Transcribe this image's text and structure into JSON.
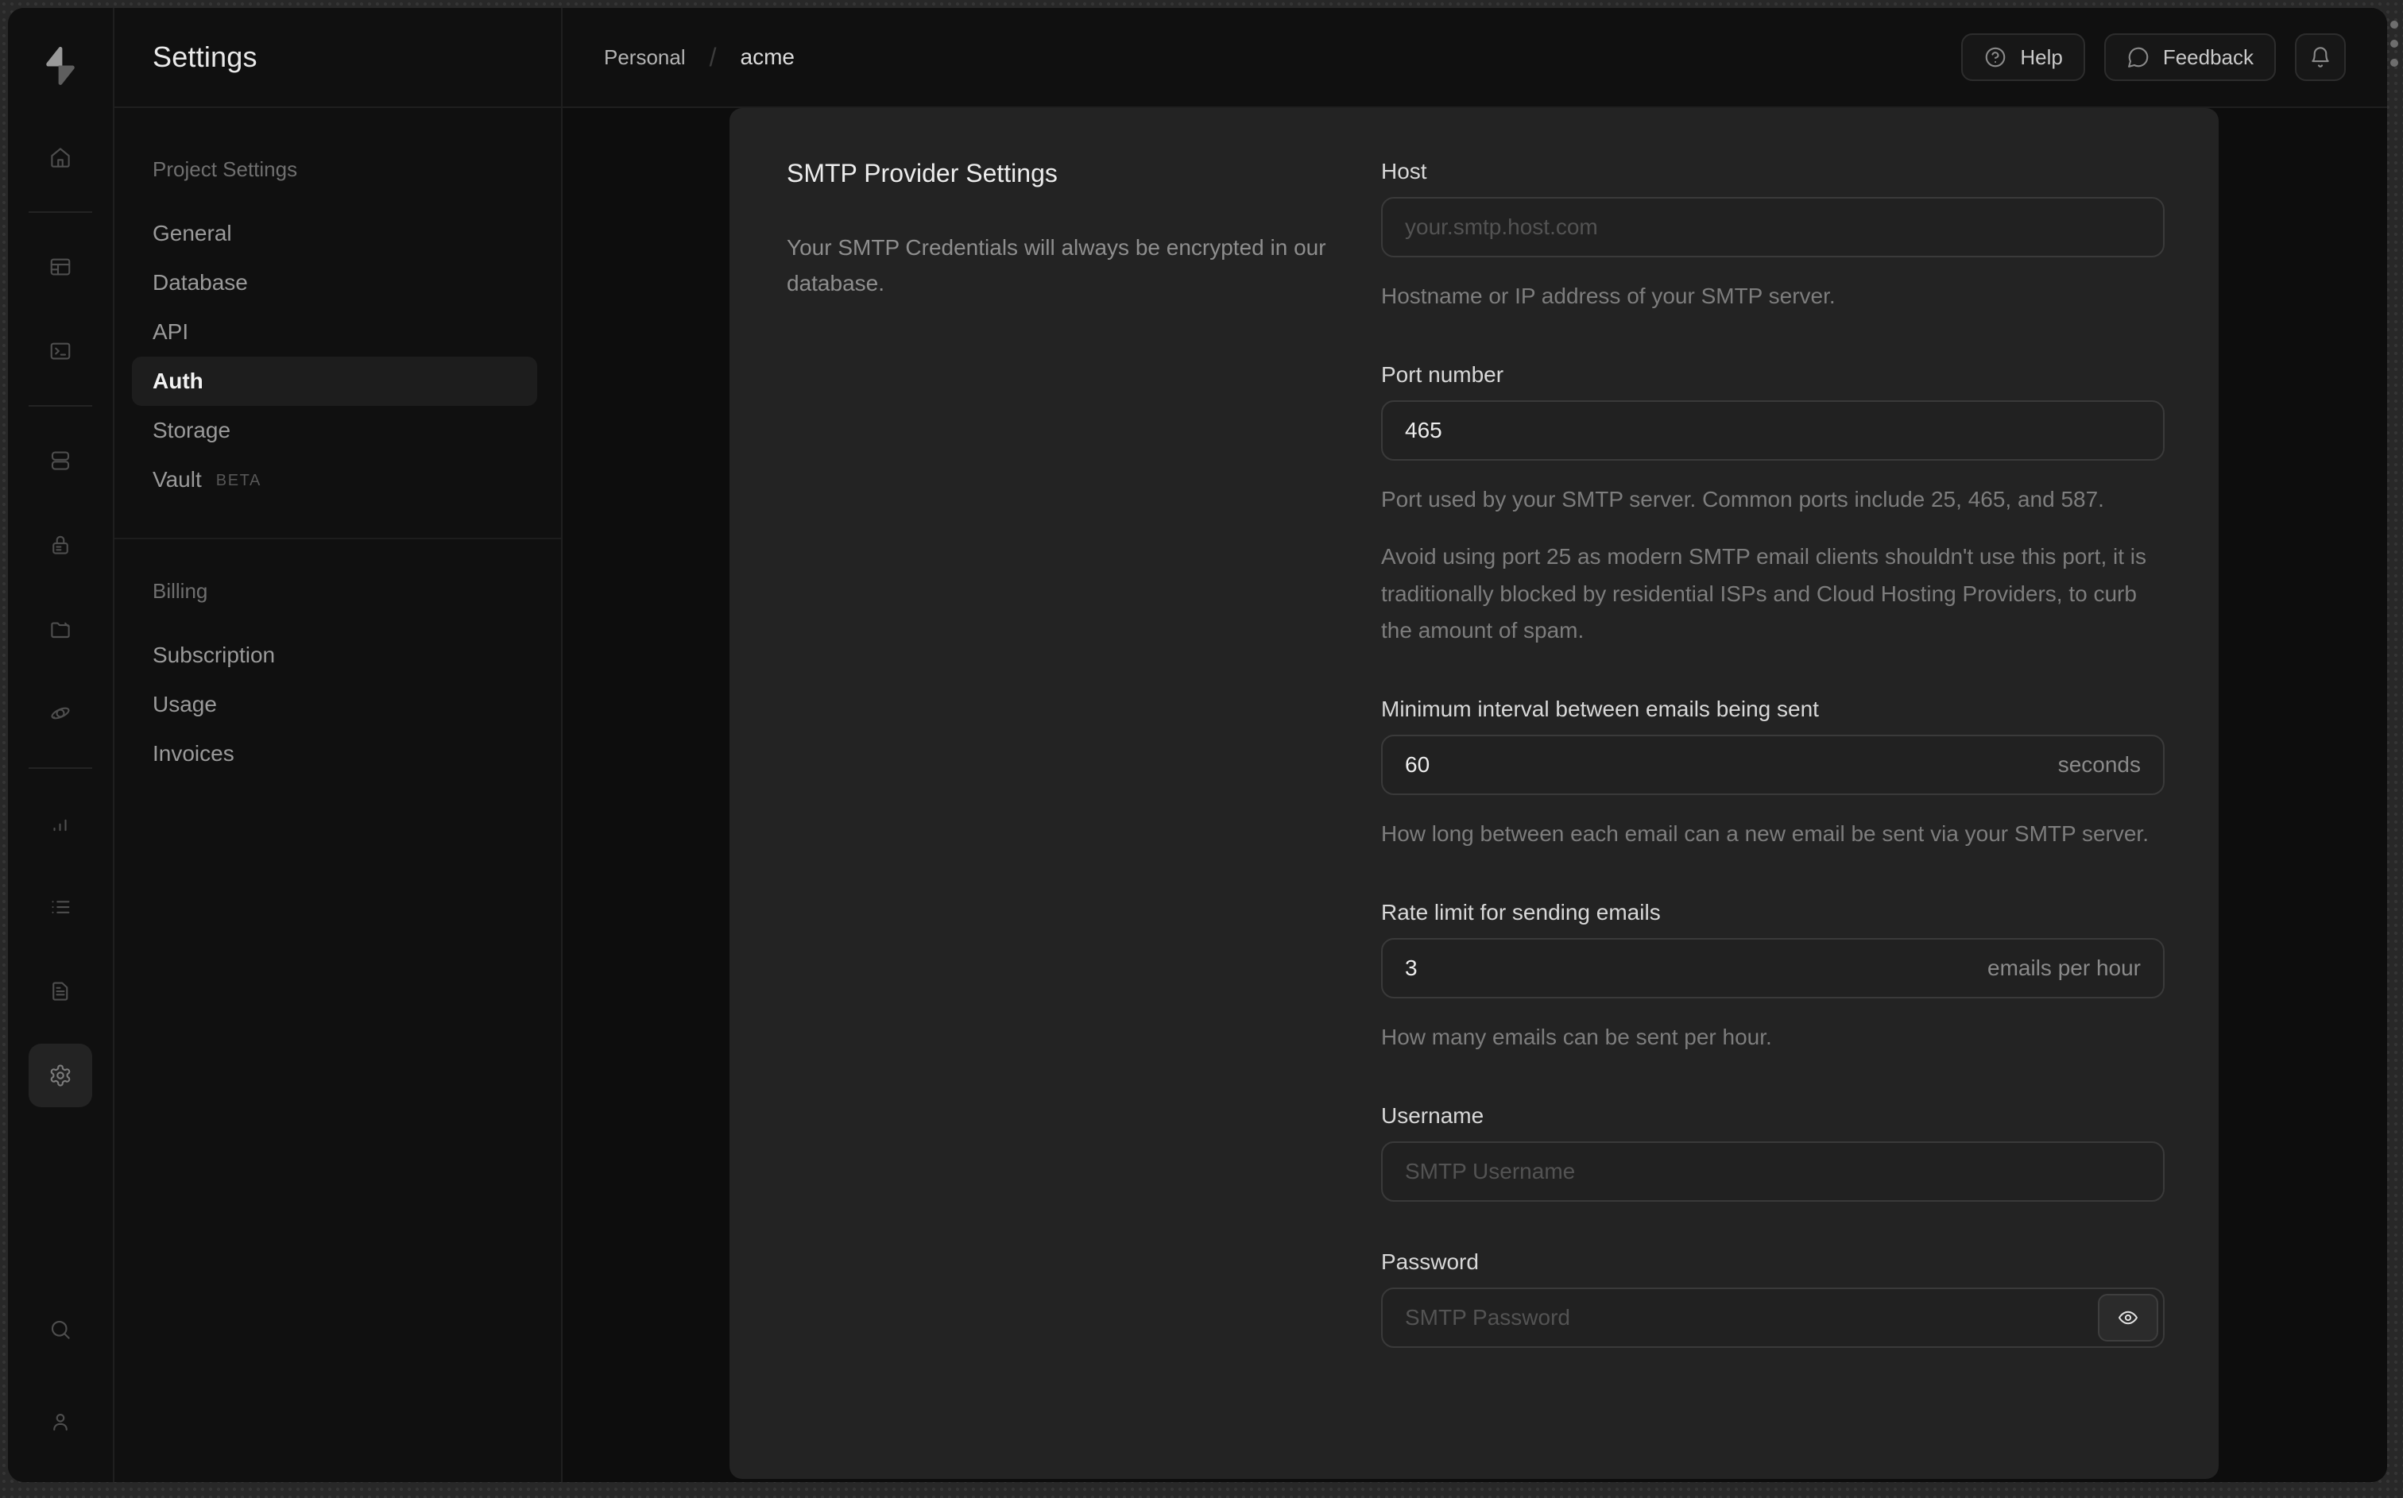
{
  "brand": {
    "logo": "supabase-logo"
  },
  "icon_rail": {
    "items": [
      {
        "icon": "home-icon"
      },
      {
        "divider": true
      },
      {
        "icon": "table-editor-icon"
      },
      {
        "icon": "sql-editor-icon"
      },
      {
        "divider": true
      },
      {
        "icon": "database-icon"
      },
      {
        "icon": "auth-icon"
      },
      {
        "icon": "storage-icon"
      },
      {
        "icon": "edge-functions-icon"
      },
      {
        "divider": true
      },
      {
        "icon": "reports-icon"
      },
      {
        "icon": "logs-icon"
      },
      {
        "icon": "docs-icon"
      },
      {
        "icon": "settings-icon",
        "active": true
      }
    ],
    "bottom": [
      {
        "icon": "search-icon"
      },
      {
        "icon": "user-icon"
      }
    ]
  },
  "sidebar": {
    "title": "Settings",
    "sections": [
      {
        "heading": "Project Settings",
        "items": [
          {
            "label": "General"
          },
          {
            "label": "Database"
          },
          {
            "label": "API"
          },
          {
            "label": "Auth",
            "active": true
          },
          {
            "label": "Storage"
          },
          {
            "label": "Vault",
            "badge": "BETA"
          }
        ]
      },
      {
        "heading": "Billing",
        "items": [
          {
            "label": "Subscription"
          },
          {
            "label": "Usage"
          },
          {
            "label": "Invoices"
          }
        ]
      }
    ]
  },
  "topbar": {
    "breadcrumb": [
      {
        "label": "Personal"
      },
      {
        "label": "acme"
      }
    ],
    "separator": "/",
    "buttons": [
      {
        "name": "help",
        "label": "Help",
        "icon": "help-circle-icon"
      },
      {
        "name": "feedback",
        "label": "Feedback",
        "icon": "message-circle-icon"
      },
      {
        "name": "notifications",
        "label": "",
        "icon": "bell-icon"
      }
    ]
  },
  "content": {
    "section_title": "SMTP Provider Settings",
    "section_description": "Your SMTP Credentials will always be encrypted in our database.",
    "fields": [
      {
        "id": "host",
        "label": "Host",
        "value": "",
        "placeholder": "your.smtp.host.com",
        "helpers": [
          "Hostname or IP address of your SMTP server."
        ]
      },
      {
        "id": "port",
        "label": "Port number",
        "value": "465",
        "placeholder": "",
        "helpers": [
          "Port used by your SMTP server. Common ports include 25, 465, and 587.",
          "Avoid using port 25 as modern SMTP email clients shouldn't use this port, it is traditionally blocked by residential ISPs and Cloud Hosting Providers, to curb the amount of spam."
        ]
      },
      {
        "id": "minimum-interval",
        "label": "Minimum interval between emails being sent",
        "value": "60",
        "suffix": "seconds",
        "placeholder": "",
        "helpers": [
          "How long between each email can a new email be sent via your SMTP server."
        ]
      },
      {
        "id": "rate-limit",
        "label": "Rate limit for sending emails",
        "value": "3",
        "suffix": "emails per hour",
        "placeholder": "",
        "helpers": [
          "How many emails can be sent per hour."
        ]
      },
      {
        "id": "username",
        "label": "Username",
        "value": "",
        "placeholder": "SMTP Username",
        "helpers": []
      },
      {
        "id": "password",
        "label": "Password",
        "value": "",
        "placeholder": "SMTP Password",
        "has_eye_button": true,
        "helpers": []
      }
    ]
  },
  "colors": {
    "backdrop": "#282828",
    "window_bg": "#101010",
    "content_bg": "#0d0d0d",
    "card_bg": "#232323",
    "input_bg": "#212121",
    "input_border": "#3a3a3a",
    "divider": "#1f1f1f",
    "text_primary": "#ececec",
    "text_muted": "#8a8a8a"
  }
}
